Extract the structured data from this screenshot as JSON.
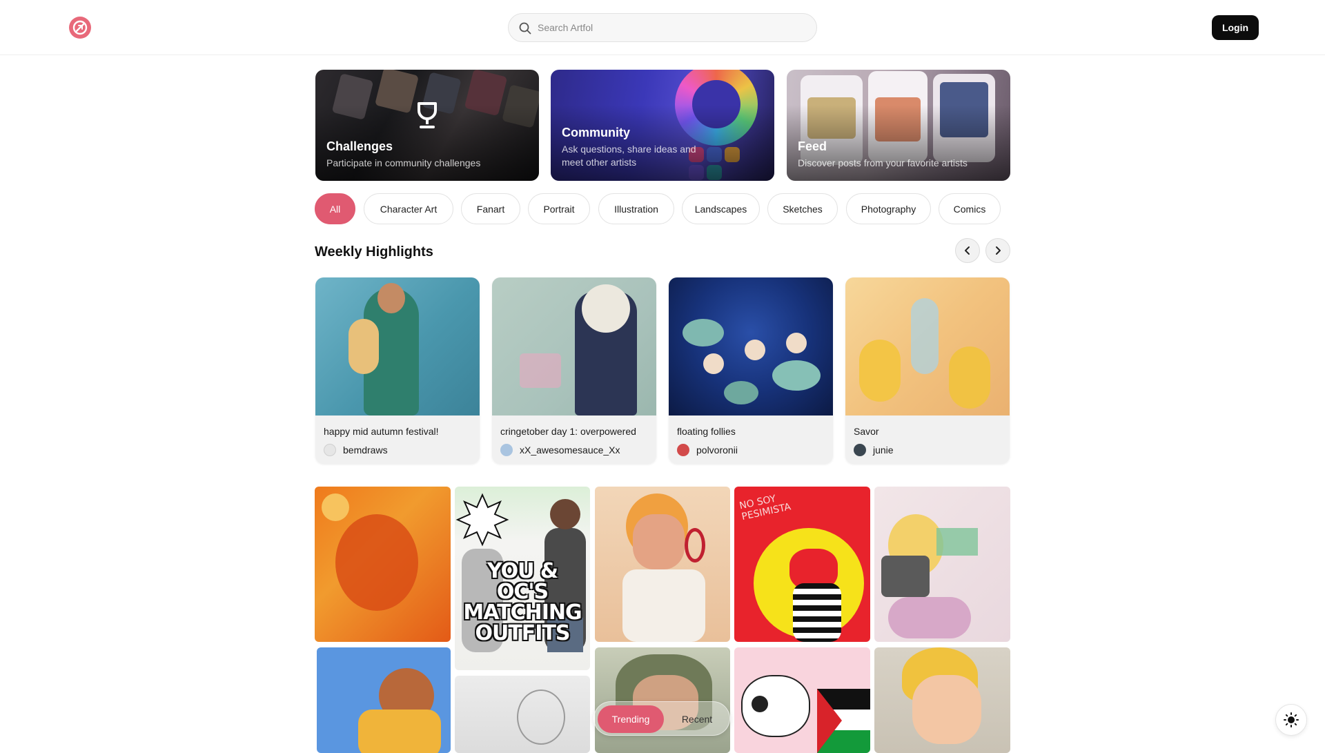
{
  "header": {
    "logo_icon": "artfol-logo-icon",
    "search_placeholder": "Search Artfol",
    "search_icon": "search-icon",
    "login_label": "Login"
  },
  "features": [
    {
      "title": "Challenges",
      "subtitle": "Participate in community challenges",
      "icon": "trophy-icon"
    },
    {
      "title": "Community",
      "subtitle": "Ask questions, share ideas and meet other artists"
    },
    {
      "title": "Feed",
      "subtitle": "Discover posts from your favorite artists"
    }
  ],
  "categories": [
    "All",
    "Character Art",
    "Fanart",
    "Portrait",
    "Illustration",
    "Landscapes",
    "Sketches",
    "Photography",
    "Comics"
  ],
  "active_category": "All",
  "highlights": {
    "title": "Weekly Highlights",
    "prev_icon": "chevron-left-icon",
    "next_icon": "chevron-right-icon",
    "items": [
      {
        "caption": "happy mid autumn festival!",
        "author": "bemdraws"
      },
      {
        "caption": "cringetober day 1: overpowered",
        "author": "xX_awesomesauce_Xx"
      },
      {
        "caption": "floating follies",
        "author": "polvoronii"
      },
      {
        "caption": "Savor",
        "author": "junie"
      }
    ]
  },
  "gallery_text": {
    "matching": "YOU & OC'S MATCHING OUTFITS",
    "nosoy": "NO SOY PESIMISTA"
  },
  "feed_toggle": {
    "trending_label": "Trending",
    "recent_label": "Recent",
    "active": "Trending"
  },
  "theme_icon": "sun-icon",
  "colors": {
    "accent": "#e05a71",
    "login_bg": "#0c0c0c"
  }
}
